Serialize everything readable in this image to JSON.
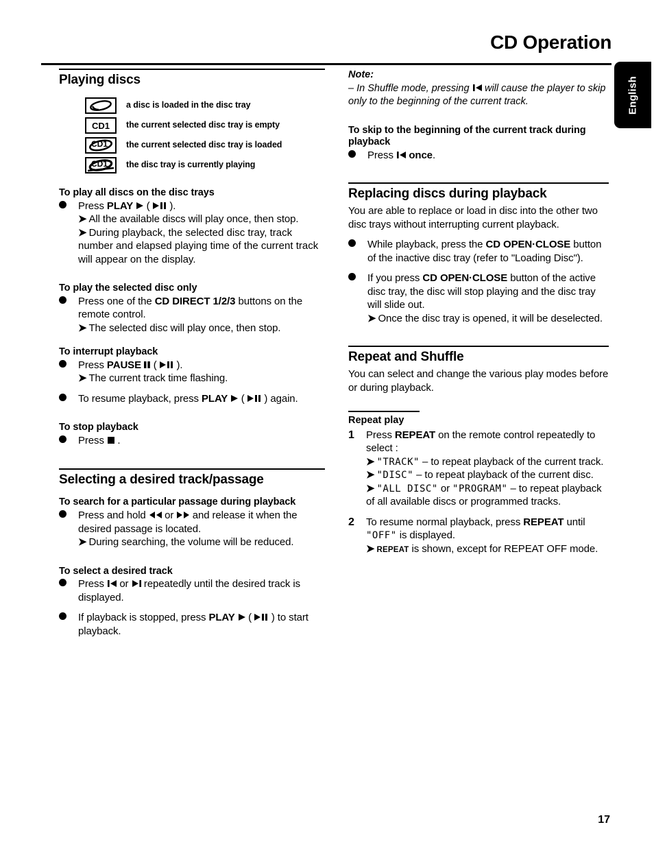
{
  "header": {
    "title": "CD Operation",
    "language_tab": "English"
  },
  "footer": {
    "page_number": "17"
  },
  "left_column": {
    "section1": {
      "heading": "Playing discs",
      "legend": [
        {
          "icon": "disc-loaded-icon",
          "label": "a disc is loaded in the disc tray"
        },
        {
          "icon": "cd1-empty-tray-icon",
          "label": "the current selected disc tray is empty",
          "icon_text": "CD1"
        },
        {
          "icon": "cd1-loaded-tray-icon",
          "label": "the current selected disc tray is loaded",
          "icon_text": "CD1"
        },
        {
          "icon": "cd1-playing-tray-icon",
          "label": "the disc tray is currently playing",
          "icon_text": "CD1"
        }
      ],
      "block1": {
        "title": "To play all discs on the disc trays",
        "bullet1_pre": "Press ",
        "bullet1_bold": "PLAY",
        "bullet1_post": ".",
        "arrow1": "All the available discs will play once, then stop.",
        "arrow2": "During playback, the selected disc tray, track number and elapsed playing time of the current track will appear on the display."
      },
      "block2": {
        "title": "To play the selected disc only",
        "bullet1_pre": "Press one of the ",
        "bullet1_bold": "CD DIRECT 1/2/3",
        "bullet1_post": " buttons on the remote control.",
        "arrow1": "The selected disc will play once, then stop."
      },
      "block3": {
        "title": "To interrupt playback",
        "bullet1_pre": "Press ",
        "bullet1_bold": "PAUSE",
        "bullet1_post": ".",
        "arrow1": "The current track time flashing.",
        "bullet2_pre": "To resume playback, press ",
        "bullet2_bold": "PLAY",
        "bullet2_post": " again."
      },
      "block4": {
        "title": "To stop playback",
        "bullet1_pre": "Press ",
        "bullet1_post": "."
      }
    },
    "section2": {
      "heading": "Selecting a desired track/passage",
      "block1": {
        "title": "To search for a particular passage during playback",
        "bullet1_pre": "Press and hold ",
        "bullet1_mid": " or ",
        "bullet1_post": " and release it when the desired passage is located.",
        "arrow1": "During searching, the volume will be reduced."
      },
      "block2": {
        "title": "To select a desired track",
        "bullet1_pre": "Press ",
        "bullet1_mid": " or ",
        "bullet1_post": " repeatedly until the desired track is displayed.",
        "bullet2_pre": "If playback is stopped, press ",
        "bullet2_bold": "PLAY",
        "bullet2_post": " to start playback."
      }
    }
  },
  "right_column": {
    "note": {
      "label": "Note:",
      "dash": "–",
      "text_pre": " In Shuffle mode, pressing ",
      "text_post": " will cause the player to skip only to the beginning of the current track."
    },
    "block_skip": {
      "title": "To skip to the beginning of the current track during playback",
      "bullet1_pre": "Press ",
      "bullet1_bold": "once",
      "bullet1_post": "."
    },
    "section_replacing": {
      "heading": "Replacing discs during playback",
      "intro": "You are able to replace or load in disc into the other two disc trays without interrupting current playback.",
      "bullet1_pre": "While playback, press the ",
      "bullet1_bold": "CD OPEN·CLOSE",
      "bullet1_post": " button of the inactive disc tray (refer to \"Loading Disc\").",
      "bullet2_pre": "If you press ",
      "bullet2_bold": "CD OPEN·CLOSE",
      "bullet2_post": " button of the active disc tray, the disc will stop playing and the disc tray will slide out.",
      "arrow1": "Once the disc tray is opened, it will be deselected."
    },
    "section_repeat": {
      "heading": "Repeat and Shuffle",
      "intro": "You can select and change the various play modes before or during playback.",
      "sub_heading": "Repeat play",
      "step1": {
        "number": "1",
        "pre": "Press ",
        "bold": "REPEAT",
        "post": " on the remote control repeatedly to select :",
        "arrow1_lcd": "\"TRACK\"",
        "arrow1_text": " – to repeat playback of the current track.",
        "arrow2_lcd": "\"DISC\"",
        "arrow2_text": " – to repeat playback of the current disc.",
        "arrow3_lcd1": "\"ALL DISC\"",
        "arrow3_mid": " or ",
        "arrow3_lcd2": "\"PROGRAM\"",
        "arrow3_text": " – to repeat playback of all available discs or programmed tracks."
      },
      "step2": {
        "number": "2",
        "pre": "To resume normal playback, press ",
        "bold": "REPEAT",
        "mid": " until ",
        "lcd": "\"OFF\"",
        "post": " is displayed.",
        "arrow1_sc": "REPEAT",
        "arrow1_text": " is shown, except for REPEAT OFF mode."
      }
    }
  },
  "glyphs": {
    "play": "play-icon",
    "play_pause": "play-pause-icon",
    "pause": "pause-icon",
    "stop": "stop-icon",
    "prev_track": "previous-track-icon",
    "next_track": "next-track-icon",
    "rewind": "rewind-icon",
    "fast_forward": "fast-forward-icon",
    "arrow": "➔"
  }
}
